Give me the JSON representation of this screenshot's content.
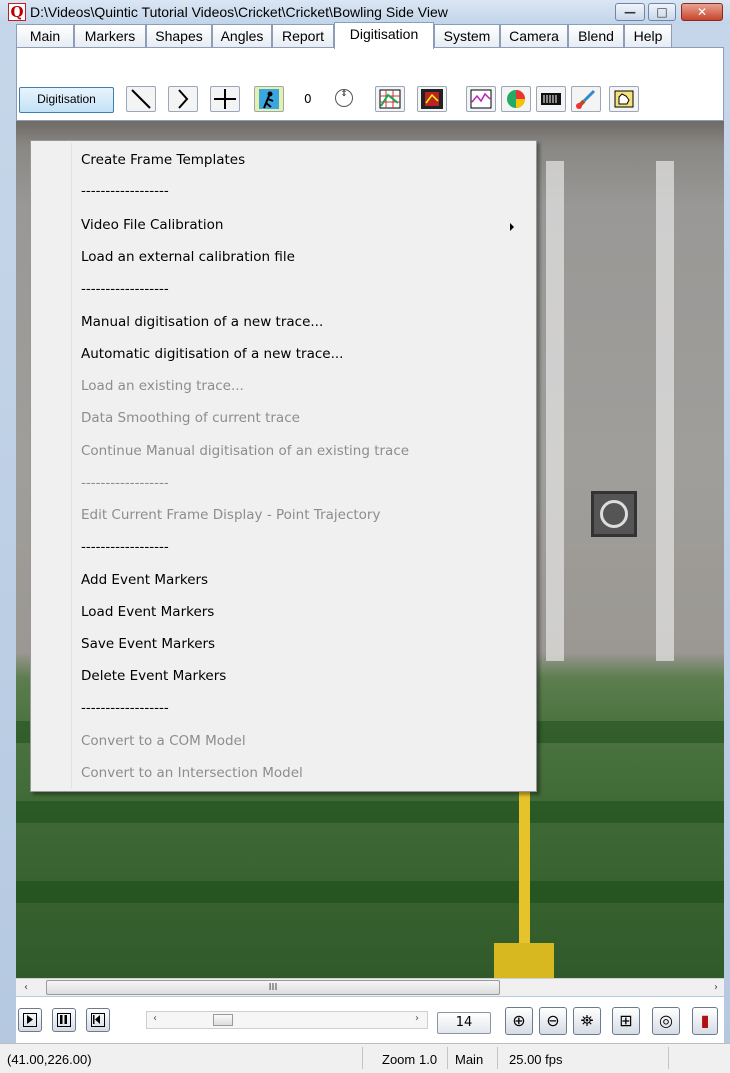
{
  "window": {
    "app_icon_letter": "Q",
    "title": "D:\\Videos\\Quintic Tutorial Videos\\Cricket\\Cricket\\Bowling Side View",
    "minimize_glyph": "—",
    "maximize_glyph": "□",
    "close_glyph": "✕"
  },
  "tabs": [
    {
      "label": "Main"
    },
    {
      "label": "Markers"
    },
    {
      "label": "Shapes"
    },
    {
      "label": "Angles"
    },
    {
      "label": "Report"
    },
    {
      "label": "Digitisation",
      "active": true
    },
    {
      "label": "System"
    },
    {
      "label": "Camera"
    },
    {
      "label": "Blend"
    },
    {
      "label": "Help"
    }
  ],
  "toolbar": {
    "digitisation_button": "Digitisation",
    "counter_value": "0",
    "spin_glyph": "⇕",
    "icons": [
      "diagonal-line-icon",
      "bracket-icon",
      "crosshair-icon",
      "runner-icon",
      "chart-grid-icon",
      "film-chart-icon",
      "graph-icon",
      "color-wheel-icon",
      "barcode-icon",
      "brush-icon",
      "hand-icon"
    ]
  },
  "menu": {
    "items": [
      {
        "label": "Create Frame Templates",
        "enabled": true
      },
      {
        "label": "------------------",
        "enabled": true,
        "separator": true
      },
      {
        "label": "Video File Calibration",
        "enabled": true,
        "submenu": true
      },
      {
        "label": "Load an external calibration file",
        "enabled": true
      },
      {
        "label": "------------------",
        "enabled": true,
        "separator": true
      },
      {
        "label": "Manual digitisation of a new trace...",
        "enabled": true
      },
      {
        "label": "Automatic digitisation of a new trace...",
        "enabled": true
      },
      {
        "label": "Load an existing trace...",
        "enabled": false
      },
      {
        "label": "Data Smoothing of current trace",
        "enabled": false
      },
      {
        "label": "Continue Manual digitisation of an existing trace",
        "enabled": false
      },
      {
        "label": "------------------",
        "enabled": false,
        "separator": true
      },
      {
        "label": "Edit Current Frame Display - Point Trajectory",
        "enabled": false
      },
      {
        "label": "------------------",
        "enabled": true,
        "separator": true
      },
      {
        "label": "Add Event Markers",
        "enabled": true
      },
      {
        "label": "Load Event Markers",
        "enabled": true
      },
      {
        "label": "Save Event Markers",
        "enabled": true
      },
      {
        "label": "Delete Event Markers",
        "enabled": true
      },
      {
        "label": "------------------",
        "enabled": true,
        "separator": true
      },
      {
        "label": "Convert to a COM Model",
        "enabled": false
      },
      {
        "label": "Convert to an Intersection Model",
        "enabled": false
      }
    ]
  },
  "scrollbar": {
    "left_arrow": "‹",
    "right_arrow": "›",
    "thumb_grip": "III"
  },
  "controls": {
    "slider_left_arrow": "‹",
    "slider_right_arrow": "›",
    "frame_number": "14",
    "icon_glyphs": [
      "⊕",
      "⊖",
      "⛯",
      "⊞",
      "◎",
      "▮"
    ]
  },
  "status": {
    "coordinates": "(41.00,226.00)",
    "zoom_label": "Zoom",
    "zoom_value": "1.0",
    "view": "Main",
    "fps": "25.00 fps"
  },
  "colors": {
    "menu_background": "#f0f0f0",
    "disabled_text": "#8d8d8d",
    "active_button": "#c3e1f6"
  }
}
